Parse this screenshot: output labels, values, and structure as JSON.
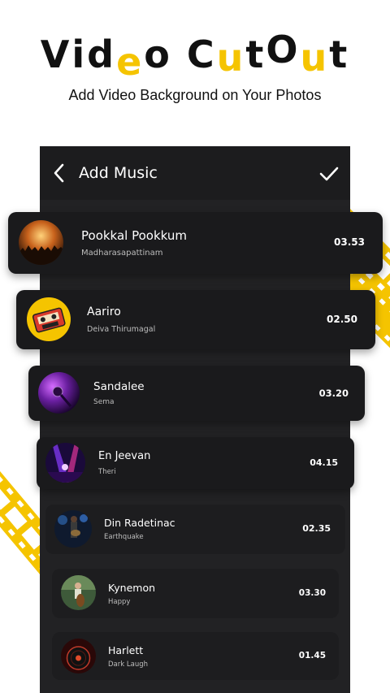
{
  "hero": {
    "title_letters": [
      "V",
      "i",
      "d",
      "e",
      "o",
      " ",
      "C",
      "u",
      "t",
      "O",
      "u",
      "t"
    ],
    "subtitle": "Add Video Background on Your Photos",
    "accent_color": "#f5c400"
  },
  "header": {
    "title": "Add Music",
    "back_icon": "chevron-left-icon",
    "confirm_icon": "check-icon"
  },
  "songs": [
    {
      "title": "Pookkal Pookkum",
      "subtitle": "Madharasapattinam",
      "duration": "03.53",
      "thumb": "concert-crowd"
    },
    {
      "title": "Aariro",
      "subtitle": "Deiva Thirumagal",
      "duration": "02.50",
      "thumb": "cassette-tape"
    },
    {
      "title": "Sandalee",
      "subtitle": "Sema",
      "duration": "03.20",
      "thumb": "microphone-purple"
    },
    {
      "title": "En Jeevan",
      "subtitle": "Theri",
      "duration": "04.15",
      "thumb": "stage-lights"
    },
    {
      "title": "Din Radetinac",
      "subtitle": "Earthquake",
      "duration": "02.35",
      "thumb": "guitarist"
    },
    {
      "title": "Kynemon",
      "subtitle": "Happy",
      "duration": "03.30",
      "thumb": "cellist"
    },
    {
      "title": "Harlett",
      "subtitle": "Dark Laugh",
      "duration": "01.45",
      "thumb": "vinyl-record"
    }
  ]
}
